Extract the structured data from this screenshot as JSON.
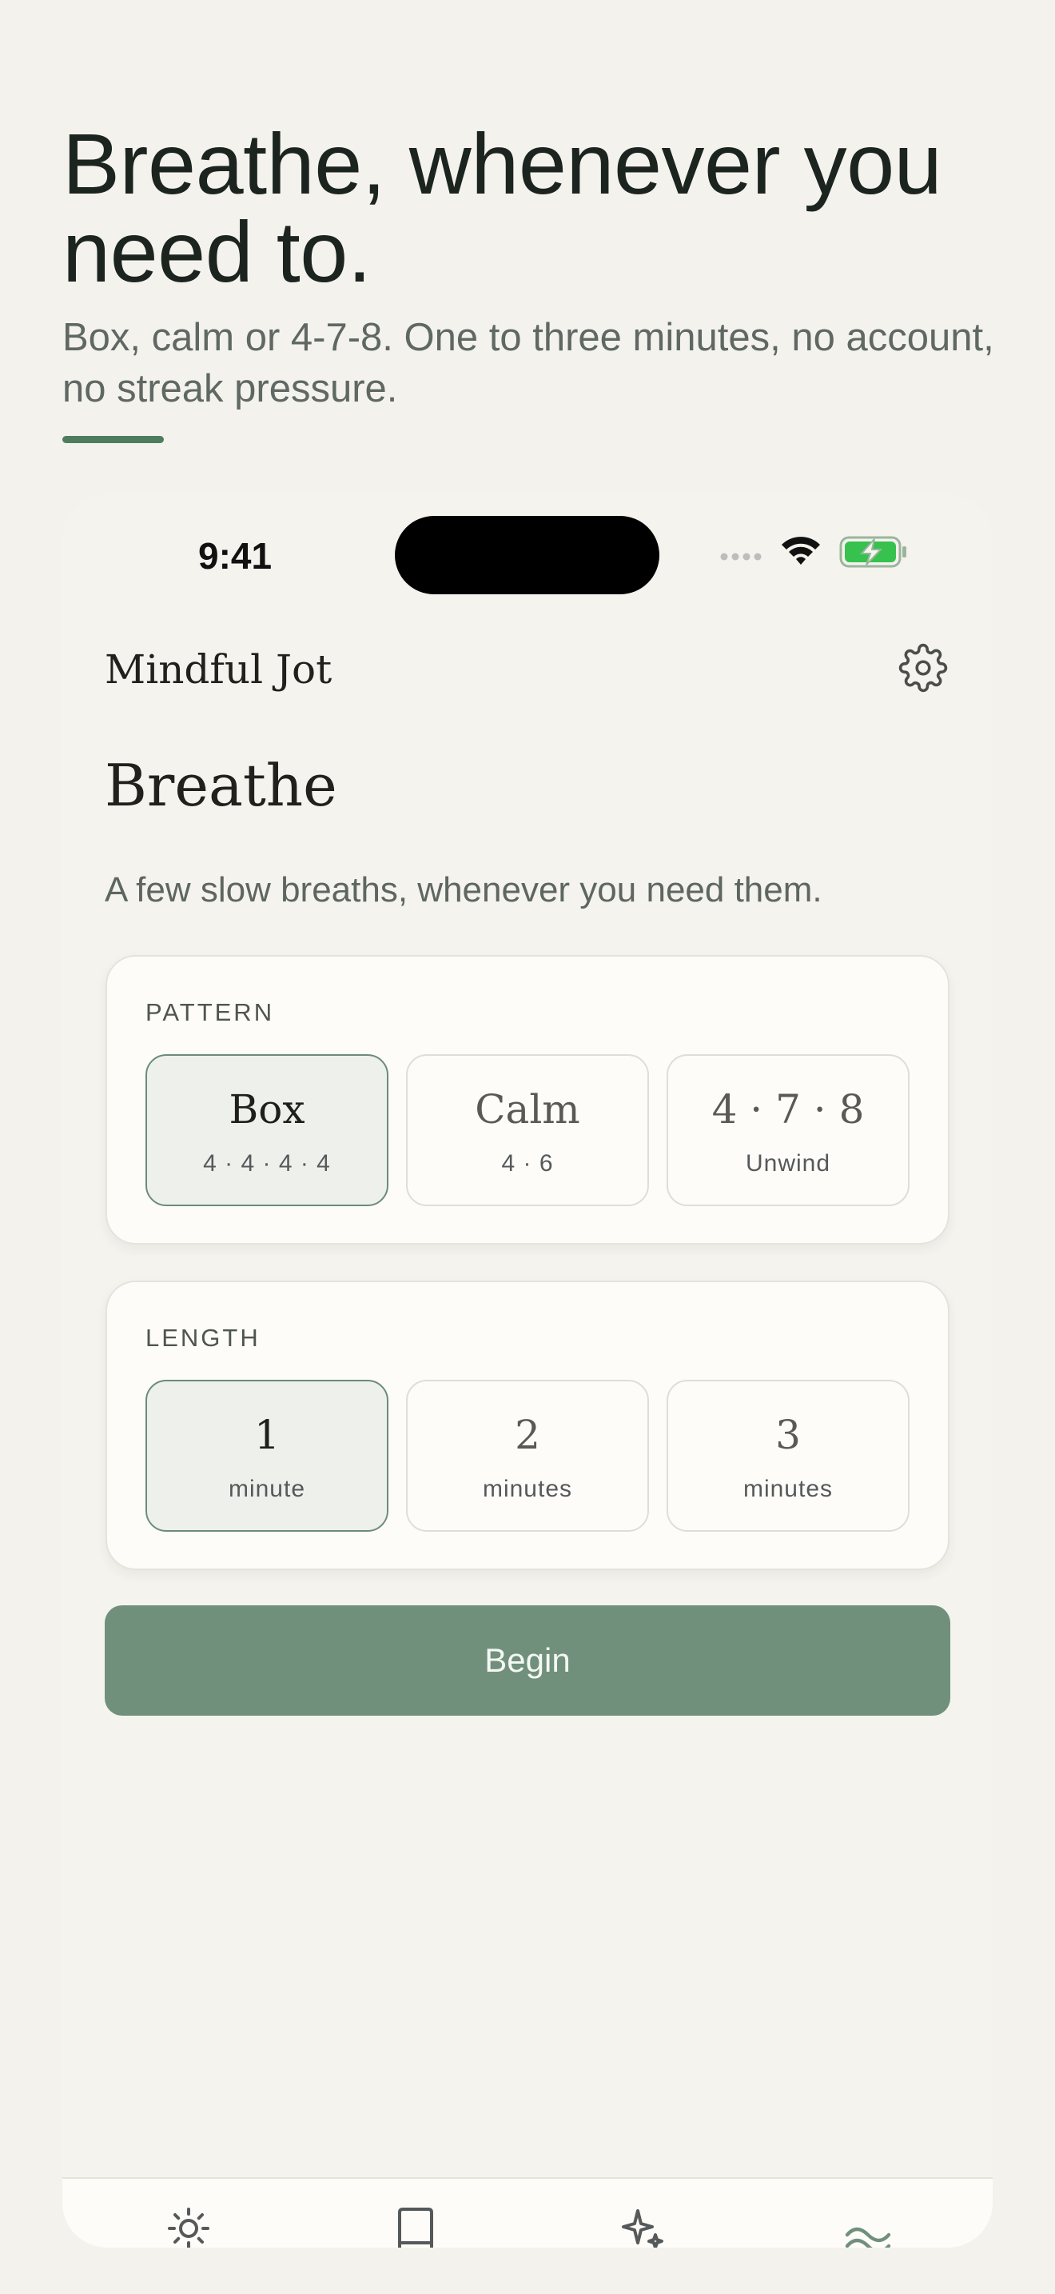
{
  "hero": {
    "title": "Breathe, whenever you need to.",
    "subtitle": "Box, calm or 4-7-8. One to three minutes, no account, no streak pressure."
  },
  "status_bar": {
    "time": "9:41",
    "icons": [
      "signal-icon",
      "wifi-icon",
      "battery-charging-icon"
    ]
  },
  "app": {
    "name": "Mindful Jot",
    "settings_icon": "gear-icon"
  },
  "page": {
    "title": "Breathe",
    "subtitle": "A few slow breaths, whenever you need them."
  },
  "pattern": {
    "label": "PATTERN",
    "options": [
      {
        "main": "Box",
        "sub": "4 · 4 · 4 · 4",
        "selected": true
      },
      {
        "main": "Calm",
        "sub": "4 · 6",
        "selected": false
      },
      {
        "main": "4 · 7 · 8",
        "sub": "Unwind",
        "selected": false
      }
    ]
  },
  "length": {
    "label": "LENGTH",
    "options": [
      {
        "main": "1",
        "sub": "minute",
        "selected": true
      },
      {
        "main": "2",
        "sub": "minutes",
        "selected": false
      },
      {
        "main": "3",
        "sub": "minutes",
        "selected": false
      }
    ]
  },
  "begin_label": "Begin",
  "tabs": [
    {
      "icon": "sun-icon"
    },
    {
      "icon": "journal-icon"
    },
    {
      "icon": "sparkle-icon"
    },
    {
      "icon": "breath-wave-icon",
      "active": true
    }
  ],
  "colors": {
    "accent": "#70907c",
    "rule": "#4e7d5e",
    "background": "#f4f2ed",
    "card": "#fdfcf8",
    "selected_fill": "#eef0eb",
    "selected_border": "#6b8c78"
  }
}
